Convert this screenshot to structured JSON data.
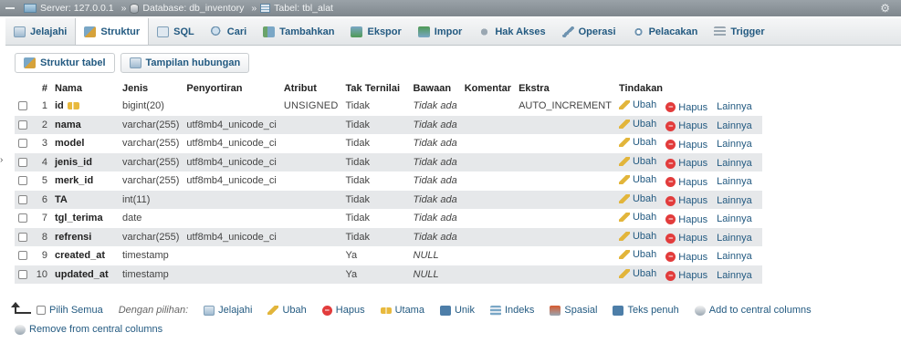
{
  "breadcrumb": {
    "server": "Server: 127.0.0.1",
    "database": "Database: db_inventory",
    "table": "Tabel: tbl_alat",
    "separator": "»"
  },
  "tabs": [
    {
      "label": "Jelajahi",
      "icon": "browse-icon"
    },
    {
      "label": "Struktur",
      "icon": "structure-icon"
    },
    {
      "label": "SQL",
      "icon": "sql-icon"
    },
    {
      "label": "Cari",
      "icon": "search-icon"
    },
    {
      "label": "Tambahkan",
      "icon": "insert-icon"
    },
    {
      "label": "Ekspor",
      "icon": "export-icon"
    },
    {
      "label": "Impor",
      "icon": "import-icon"
    },
    {
      "label": "Hak Akses",
      "icon": "privileges-icon"
    },
    {
      "label": "Operasi",
      "icon": "operations-icon"
    },
    {
      "label": "Pelacakan",
      "icon": "tracking-icon"
    },
    {
      "label": "Trigger",
      "icon": "trigger-icon"
    }
  ],
  "active_tab": "Struktur",
  "subtabs": [
    {
      "label": "Struktur tabel"
    },
    {
      "label": "Tampilan hubungan"
    }
  ],
  "table_headers": {
    "num": "#",
    "nama": "Nama",
    "jenis": "Jenis",
    "penyortiran": "Penyortiran",
    "atribut": "Atribut",
    "tak_ternilai": "Tak Ternilai",
    "bawaan": "Bawaan",
    "komentar": "Komentar",
    "ekstra": "Ekstra",
    "tindakan": "Tindakan"
  },
  "actions": {
    "ubah": "Ubah",
    "hapus": "Hapus",
    "lainnya": "Lainnya"
  },
  "rows": [
    {
      "num": "1",
      "nama": "id",
      "jenis": "bigint(20)",
      "penyortiran": "",
      "atribut": "UNSIGNED",
      "tak_ternilai": "Tidak",
      "bawaan": "Tidak ada",
      "komentar": "",
      "ekstra": "AUTO_INCREMENT"
    },
    {
      "num": "2",
      "nama": "nama",
      "jenis": "varchar(255)",
      "penyortiran": "utf8mb4_unicode_ci",
      "atribut": "",
      "tak_ternilai": "Tidak",
      "bawaan": "Tidak ada",
      "komentar": "",
      "ekstra": ""
    },
    {
      "num": "3",
      "nama": "model",
      "jenis": "varchar(255)",
      "penyortiran": "utf8mb4_unicode_ci",
      "atribut": "",
      "tak_ternilai": "Tidak",
      "bawaan": "Tidak ada",
      "komentar": "",
      "ekstra": ""
    },
    {
      "num": "4",
      "nama": "jenis_id",
      "jenis": "varchar(255)",
      "penyortiran": "utf8mb4_unicode_ci",
      "atribut": "",
      "tak_ternilai": "Tidak",
      "bawaan": "Tidak ada",
      "komentar": "",
      "ekstra": ""
    },
    {
      "num": "5",
      "nama": "merk_id",
      "jenis": "varchar(255)",
      "penyortiran": "utf8mb4_unicode_ci",
      "atribut": "",
      "tak_ternilai": "Tidak",
      "bawaan": "Tidak ada",
      "komentar": "",
      "ekstra": ""
    },
    {
      "num": "6",
      "nama": "TA",
      "jenis": "int(11)",
      "penyortiran": "",
      "atribut": "",
      "tak_ternilai": "Tidak",
      "bawaan": "Tidak ada",
      "komentar": "",
      "ekstra": ""
    },
    {
      "num": "7",
      "nama": "tgl_terima",
      "jenis": "date",
      "penyortiran": "",
      "atribut": "",
      "tak_ternilai": "Tidak",
      "bawaan": "Tidak ada",
      "komentar": "",
      "ekstra": ""
    },
    {
      "num": "8",
      "nama": "refrensi",
      "jenis": "varchar(255)",
      "penyortiran": "utf8mb4_unicode_ci",
      "atribut": "",
      "tak_ternilai": "Tidak",
      "bawaan": "Tidak ada",
      "komentar": "",
      "ekstra": ""
    },
    {
      "num": "9",
      "nama": "created_at",
      "jenis": "timestamp",
      "penyortiran": "",
      "atribut": "",
      "tak_ternilai": "Ya",
      "bawaan": "NULL",
      "komentar": "",
      "ekstra": ""
    },
    {
      "num": "10",
      "nama": "updated_at",
      "jenis": "timestamp",
      "penyortiran": "",
      "atribut": "",
      "tak_ternilai": "Ya",
      "bawaan": "NULL",
      "komentar": "",
      "ekstra": ""
    }
  ],
  "bottom": {
    "select_all": "Pilih Semua",
    "with_selected": "Dengan pilihan:",
    "items": [
      {
        "label": "Jelajahi",
        "icon": "browse-icon"
      },
      {
        "label": "Ubah",
        "icon": "pencil-icon"
      },
      {
        "label": "Hapus",
        "icon": "delete-icon"
      },
      {
        "label": "Utama",
        "icon": "primary-key-icon"
      },
      {
        "label": "Unik",
        "icon": "unique-icon"
      },
      {
        "label": "Indeks",
        "icon": "index-icon"
      },
      {
        "label": "Spasial",
        "icon": "spatial-icon"
      },
      {
        "label": "Teks penuh",
        "icon": "fulltext-icon"
      },
      {
        "label": "Add to central columns",
        "icon": "add-central-icon"
      }
    ],
    "remove_central": "Remove from central columns"
  },
  "colors": {
    "link": "#235a81",
    "row_alt": "#e6e8ea",
    "delete": "#e23c3c",
    "key": "#e8b93d"
  }
}
